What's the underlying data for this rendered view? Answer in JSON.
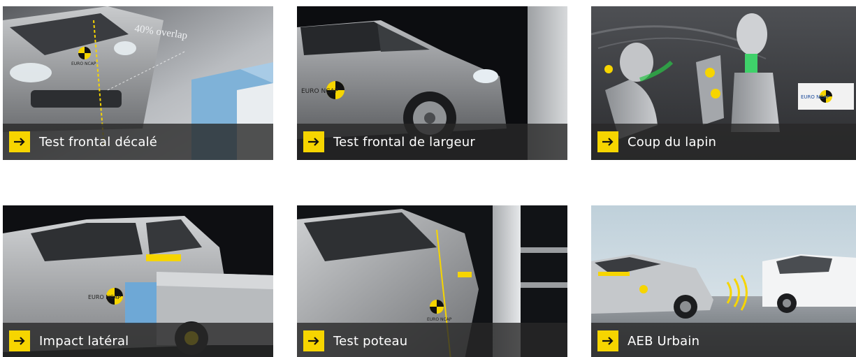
{
  "accent_color": "#f6d500",
  "arrow_icon": "arrow-right-icon",
  "tiles": [
    {
      "label": "Test frontal décalé",
      "overlay_text": "40% overlap",
      "logo": "EURO NCAP"
    },
    {
      "label": "Test frontal de largeur",
      "logo": "EURO NCAP"
    },
    {
      "label": "Coup du lapin",
      "logo": "EURO NCAP"
    },
    {
      "label": "Impact latéral",
      "logo": "EURO NCAP"
    },
    {
      "label": "Test poteau",
      "logo": "EURO NCAP"
    },
    {
      "label": "AEB Urbain"
    }
  ]
}
